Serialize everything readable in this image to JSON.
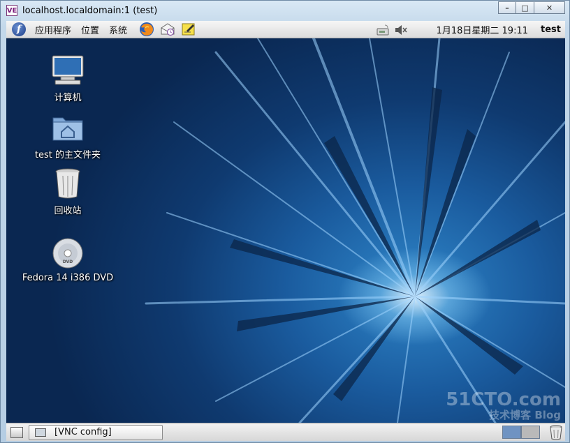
{
  "window": {
    "title": "localhost.localdomain:1 (test)",
    "app_icon_text": "VE",
    "buttons": {
      "minimize": "–",
      "maximize": "□",
      "close": "✕"
    }
  },
  "top_panel": {
    "menus": [
      "应用程序",
      "位置",
      "系统"
    ],
    "launchers": [
      "firefox-icon",
      "mail-icon",
      "notes-icon"
    ],
    "tray": [
      "network-icon",
      "volume-icon"
    ],
    "clock": "1月18日星期二 19:11",
    "user": "test"
  },
  "desktop_icons": [
    {
      "label": "计算机",
      "icon": "computer-icon"
    },
    {
      "label": "test 的主文件夹",
      "icon": "home-folder-icon"
    },
    {
      "label": "回收站",
      "icon": "trash-icon"
    },
    {
      "label": "Fedora 14 i386 DVD",
      "icon": "dvd-icon"
    }
  ],
  "watermark": {
    "main": "51CTO.com",
    "sub": "技术博客 Blog"
  },
  "bottom_panel": {
    "task": "[VNC config]",
    "workspaces": [
      "active",
      "inactive"
    ]
  },
  "colors": {
    "desktop_dark": "#0a2751",
    "desktop_mid": "#1a5b9e",
    "panel": "#e4e4e4",
    "workspace_active": "#6f93c2"
  }
}
